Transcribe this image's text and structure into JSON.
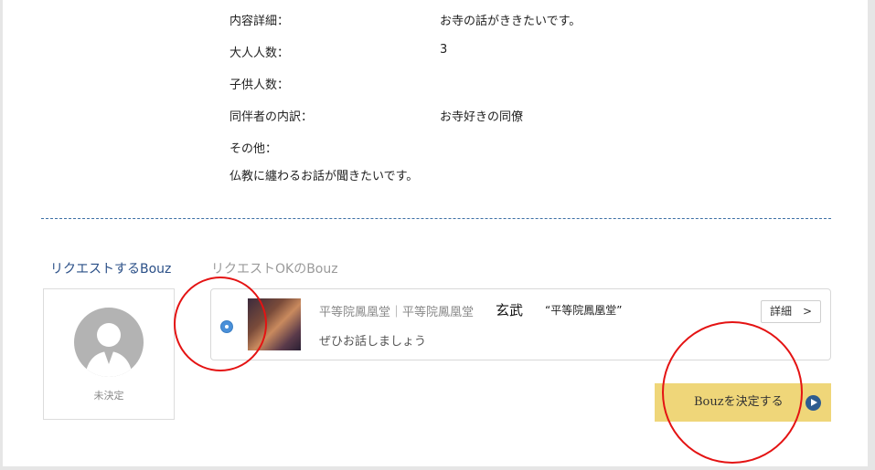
{
  "details": [
    {
      "label": "内容詳細：",
      "value": "お寺の話がききたいです。"
    },
    {
      "label": "大人人数：",
      "value": "3"
    },
    {
      "label": "子供人数：",
      "value": ""
    },
    {
      "label": "同伴者の内訳：",
      "value": "お寺好きの同僚"
    },
    {
      "label": "その他：",
      "value": ""
    }
  ],
  "other_text": "仏教に纏わるお話が聞きたいです。",
  "request_section": {
    "title": "リクエストするBouz",
    "undecided_label": "未決定"
  },
  "ok_section": {
    "title": "リクエストOKのBouz",
    "card": {
      "temple": "平等院鳳凰堂｜平等院鳳凰堂",
      "name": "玄武",
      "quote": "“平等院鳳凰堂”",
      "message": "ぜひお話しましょう",
      "detail_button": "詳細　>"
    }
  },
  "decide_button": "Bouzを決定する",
  "colors": {
    "accent_blue": "#2a4f87",
    "button_yellow": "#efd679",
    "annotation_red": "#e41313",
    "radio_blue": "#4a90d9"
  }
}
